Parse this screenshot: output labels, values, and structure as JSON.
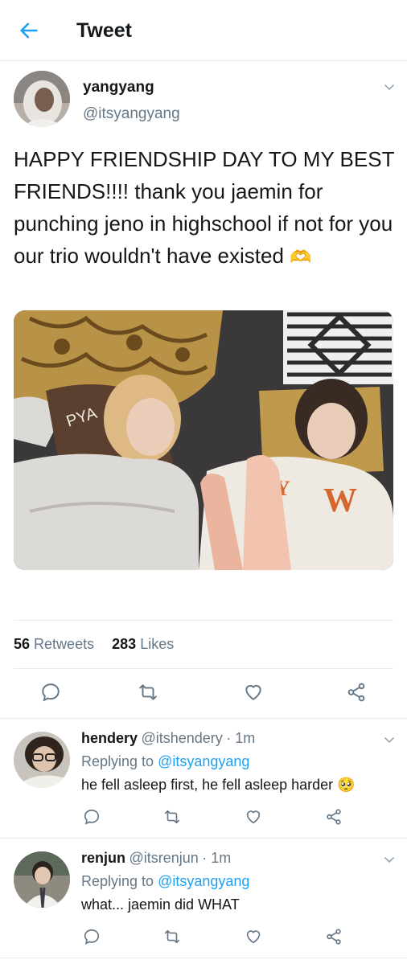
{
  "header": {
    "title": "Tweet"
  },
  "tweet": {
    "name": "yangyang",
    "handle": "@itsyangyang",
    "text": "HAPPY FRIENDSHIP DAY TO MY BEST FRIENDS!!!! thank you jaemin for punching jeno in highschool if not for you our trio wouldn't have existed",
    "emoji": "🫶",
    "retweets_count": "56",
    "retweets_label": "Retweets",
    "likes_count": "283",
    "likes_label": "Likes"
  },
  "replies": [
    {
      "name": "hendery",
      "handle": "@itshendery",
      "time": "· 1m",
      "replying_label": "Replying to",
      "replying_to": "@itsyangyang",
      "text": "he fell asleep first, he fell asleep harder",
      "emoji": "🥺"
    },
    {
      "name": "renjun",
      "handle": "@itsrenjun",
      "time": "· 1m",
      "replying_label": "Replying to",
      "replying_to": "@itsyangyang",
      "text": "what... jaemin did WHAT",
      "emoji": ""
    }
  ],
  "icons": {
    "back": "arrow-left-icon",
    "reply": "comment-icon",
    "retweet": "retweet-icon",
    "like": "heart-icon",
    "share": "share-icon",
    "more": "chevron-down-icon"
  },
  "colors": {
    "accent": "#1da1f2",
    "muted": "#657786",
    "text": "#14171a",
    "divider": "#e6ecf0"
  }
}
